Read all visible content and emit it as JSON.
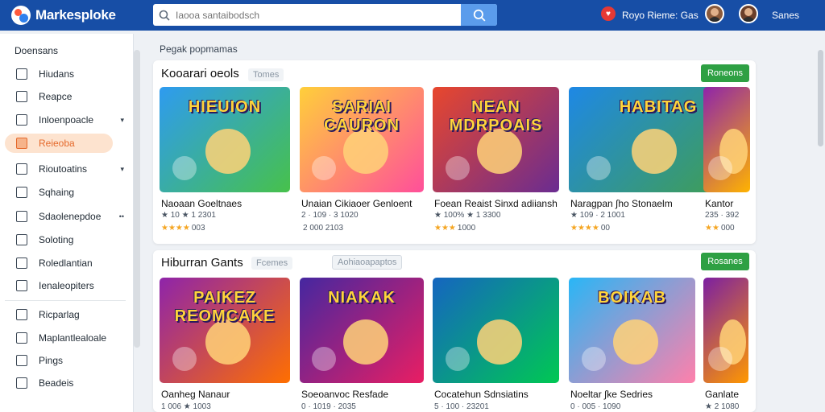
{
  "header": {
    "app_name": "Markesploke",
    "search_placeholder": "Iaooa santaibodsch",
    "user_label": "Royo Rieme: Gas",
    "games_label": "Sanes"
  },
  "sidebar": {
    "title": "Doensans",
    "items": [
      {
        "label": "Hiudans",
        "icon": "people-icon",
        "chevron": ""
      },
      {
        "label": "Reapce",
        "icon": "list-icon",
        "chevron": ""
      },
      {
        "label": "Inloenpoacle",
        "icon": "folder-icon",
        "chevron": "▾"
      },
      {
        "label": "Reieoba",
        "icon": "grid-icon",
        "chevron": "",
        "active": true
      },
      {
        "label": "Rioutoatins",
        "icon": "chart-icon",
        "chevron": "▾"
      },
      {
        "label": "Sqhaing",
        "icon": "edit-icon",
        "chevron": ""
      },
      {
        "label": "Sdaolenepdoe",
        "icon": "calendar-icon",
        "chevron": "••"
      },
      {
        "label": "Soloting",
        "icon": "settings-icon",
        "chevron": ""
      },
      {
        "label": "Roledlantian",
        "icon": "user-icon",
        "chevron": ""
      },
      {
        "label": "Ienaleopiters",
        "icon": "document-icon",
        "chevron": ""
      },
      {
        "label": "Ricparlag",
        "icon": "tag-icon",
        "chevron": ""
      },
      {
        "label": "Maplantlealoale",
        "icon": "map-icon",
        "chevron": ""
      },
      {
        "label": "Pings",
        "icon": "link-icon",
        "chevron": ""
      },
      {
        "label": "Beadeis",
        "icon": "box-icon",
        "chevron": ""
      }
    ]
  },
  "breadcrumb": "Pegak popmamas",
  "sections": [
    {
      "title": "Kooarari oeols",
      "tag": "Tomes",
      "tag2": "",
      "button": "Roneons",
      "cards": [
        {
          "thumb_text": "HIEUION",
          "title": "Naoaan Goeltnaes",
          "sub": "★ 10 ★ 1 2301",
          "stars": "★★★★",
          "count": "003"
        },
        {
          "thumb_text": "SARIAI CAURON",
          "title": "Unaian Cikiaoer Genloent",
          "sub": "2 · 109 · 3 1020",
          "stars": "",
          "count": "2 000 2103"
        },
        {
          "thumb_text": "NEAN MDRPOAIS",
          "title": "Foean Reaist Sinxd adiiansh",
          "sub": "★ 100% ★ 1 3300",
          "stars": "★★★",
          "count": "1000"
        },
        {
          "thumb_text": "HABITAG",
          "title": "Naragpan ∫ho Stonaelm",
          "sub": "★ 109 · 2 1001",
          "stars": "★★★★",
          "count": "00"
        },
        {
          "thumb_text": "",
          "title": "Kantor",
          "sub": "235 · 392",
          "stars": "★★",
          "count": "000"
        }
      ]
    },
    {
      "title": "Hiburran Gants",
      "tag": "Fcemes",
      "tag2": "Aohiaoapaptos",
      "button": "Rosanes",
      "cards": [
        {
          "thumb_text": "PAIKEZ REOMCAKE",
          "title": "Oanheg Nanaur",
          "sub": "1 006 ★ 1003",
          "stars": "",
          "count": ""
        },
        {
          "thumb_text": "NIAKAK",
          "title": "Soeoanvoc Resfade",
          "sub": "0 · 1019 · 2035",
          "stars": "",
          "count": ""
        },
        {
          "thumb_text": "",
          "title": "Cocatehun Sdnsiatins",
          "sub": "5 · 100 · 23201",
          "stars": "",
          "count": ""
        },
        {
          "thumb_text": "BOIKAB",
          "title": "Noeltar ∫ke Sedries",
          "sub": "0 · 005 · 1090",
          "stars": "",
          "count": ""
        },
        {
          "thumb_text": "",
          "title": "Ganlate",
          "sub": "★ 2 1080",
          "stars": "",
          "count": ""
        }
      ]
    }
  ],
  "colors": {
    "header_bg": "#174ea6",
    "accent_button": "#2ea043",
    "active_item": "#e5692b"
  }
}
